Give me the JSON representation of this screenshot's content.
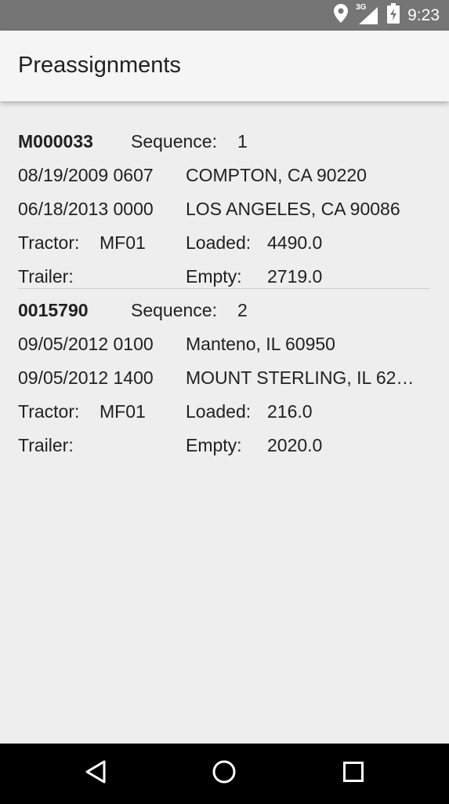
{
  "status_bar": {
    "time": "9:23",
    "icons": [
      "location-icon",
      "signal-3g-icon",
      "battery-icon"
    ],
    "network_label": "3G"
  },
  "app_bar": {
    "title": "Preassignments"
  },
  "labels": {
    "sequence": "Sequence:",
    "tractor": "Tractor:",
    "trailer": "Trailer:",
    "loaded": "Loaded:",
    "empty": "Empty:"
  },
  "assignments": [
    {
      "id": "M000033",
      "sequence": "1",
      "origin_datetime": "08/19/2009 0607",
      "origin_location": "COMPTON, CA 90220",
      "dest_datetime": "06/18/2013 0000",
      "dest_location": "LOS ANGELES, CA 90086",
      "tractor": "MF01",
      "trailer": "",
      "loaded": "4490.0",
      "empty": "2719.0"
    },
    {
      "id": "0015790",
      "sequence": "2",
      "origin_datetime": "09/05/2012 0100",
      "origin_location": "Manteno, IL 60950",
      "dest_datetime": "09/05/2012 1400",
      "dest_location": "MOUNT STERLING, IL 62…",
      "tractor": "MF01",
      "trailer": "",
      "loaded": "216.0",
      "empty": "2020.0"
    }
  ],
  "nav_bar": {
    "buttons": [
      "back-icon",
      "home-icon",
      "recents-icon"
    ]
  }
}
